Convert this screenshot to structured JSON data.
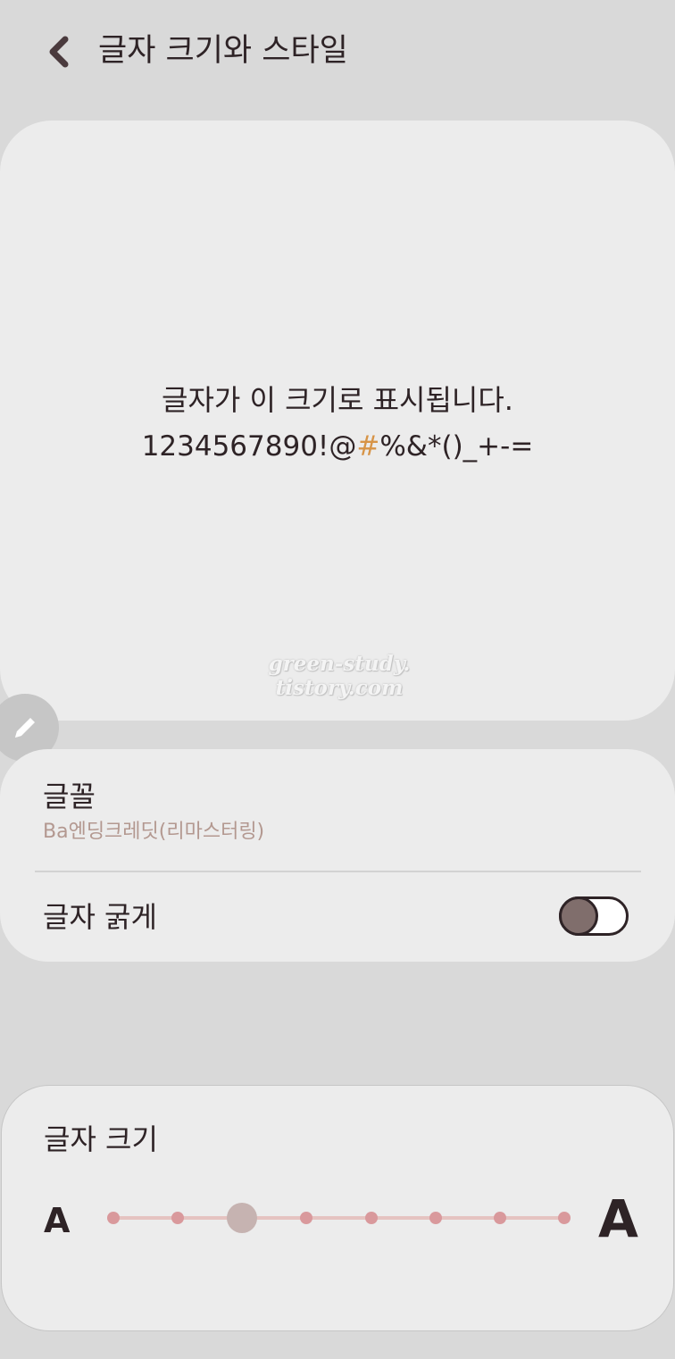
{
  "header": {
    "title": "글자 크기와 스타일",
    "back_icon": "chevron-left-icon"
  },
  "preview": {
    "line1": "글자가 이 크기로 표시됩니다.",
    "line2_before": "1234567890!@",
    "line2_hash": "#",
    "line2_after": "%&*()_+-=",
    "watermark_line1": "green-study.",
    "watermark_line2": "tistory.com",
    "edit_icon": "pencil-icon"
  },
  "settings": {
    "font_label": "글꼴",
    "font_value": "Ba엔딩크레딧(리마스터링)",
    "bold_label": "글자 굵게",
    "bold_enabled": false
  },
  "font_size": {
    "label": "글자 크기",
    "small_glyph": "A",
    "large_glyph": "A",
    "steps": 8,
    "current_step": 3
  },
  "colors": {
    "background": "#d9d9d9",
    "card": "#ececec",
    "text": "#2e2326",
    "accent_hash": "#d79447",
    "secondary_text": "#b39890",
    "slider_dot": "#d9999c",
    "slider_track": "#e5c3c1",
    "slider_thumb": "#c6b3b1",
    "toggle_thumb": "#806e6c"
  }
}
